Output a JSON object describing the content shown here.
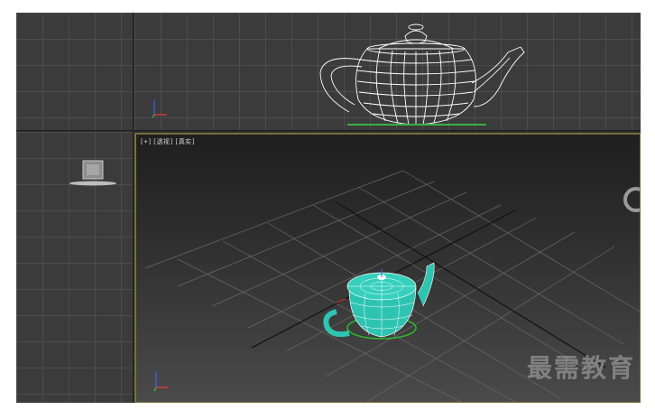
{
  "viewports": {
    "perspective": {
      "label_plus": "[+]",
      "label_view": "[透视]",
      "label_shading": "[真实]"
    }
  },
  "scene": {
    "object": "teapot",
    "selection_color": "#2fc4b2",
    "wire_color": "#ffffff",
    "active_border_color": "#7a6e3c"
  },
  "icons": [
    "axis-tripod-icon",
    "viewcube-icon",
    "viewport-orbit-icon"
  ],
  "watermark": {
    "text": "最需教育"
  }
}
